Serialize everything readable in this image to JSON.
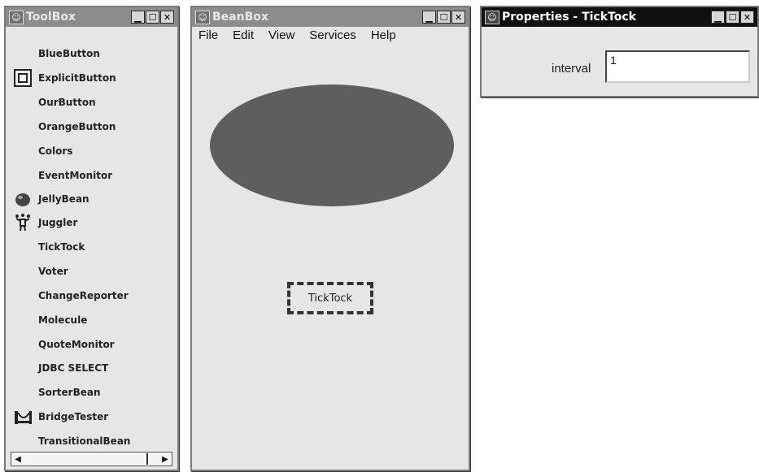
{
  "toolbox": {
    "title": "ToolBox",
    "items": [
      {
        "label": "BlueButton",
        "icon": "none"
      },
      {
        "label": "ExplicitButton",
        "icon": "button-icon"
      },
      {
        "label": "OurButton",
        "icon": "none"
      },
      {
        "label": "OrangeButton",
        "icon": "none"
      },
      {
        "label": "Colors",
        "icon": "none"
      },
      {
        "label": "EventMonitor",
        "icon": "none"
      },
      {
        "label": "JellyBean",
        "icon": "jellybean-icon"
      },
      {
        "label": "Juggler",
        "icon": "juggler-icon"
      },
      {
        "label": "TickTock",
        "icon": "none"
      },
      {
        "label": "Voter",
        "icon": "none"
      },
      {
        "label": "ChangeReporter",
        "icon": "none"
      },
      {
        "label": "Molecule",
        "icon": "none"
      },
      {
        "label": "QuoteMonitor",
        "icon": "none"
      },
      {
        "label": "JDBC SELECT",
        "icon": "none"
      },
      {
        "label": "SorterBean",
        "icon": "none"
      },
      {
        "label": "BridgeTester",
        "icon": "bridge-icon"
      },
      {
        "label": "TransitionalBean",
        "icon": "none"
      }
    ]
  },
  "beanbox": {
    "title": "BeanBox",
    "menu": [
      "File",
      "Edit",
      "View",
      "Services",
      "Help"
    ],
    "selected_bean_label": "TickTock"
  },
  "properties": {
    "title": "Properties - TickTock",
    "field_label": "interval",
    "field_value": "1"
  },
  "colors": {
    "window_bg": "#e6e6e6",
    "inactive_title": "#8c8c8c",
    "active_title": "#101010",
    "ellipse_fill": "#5e5e5e"
  }
}
